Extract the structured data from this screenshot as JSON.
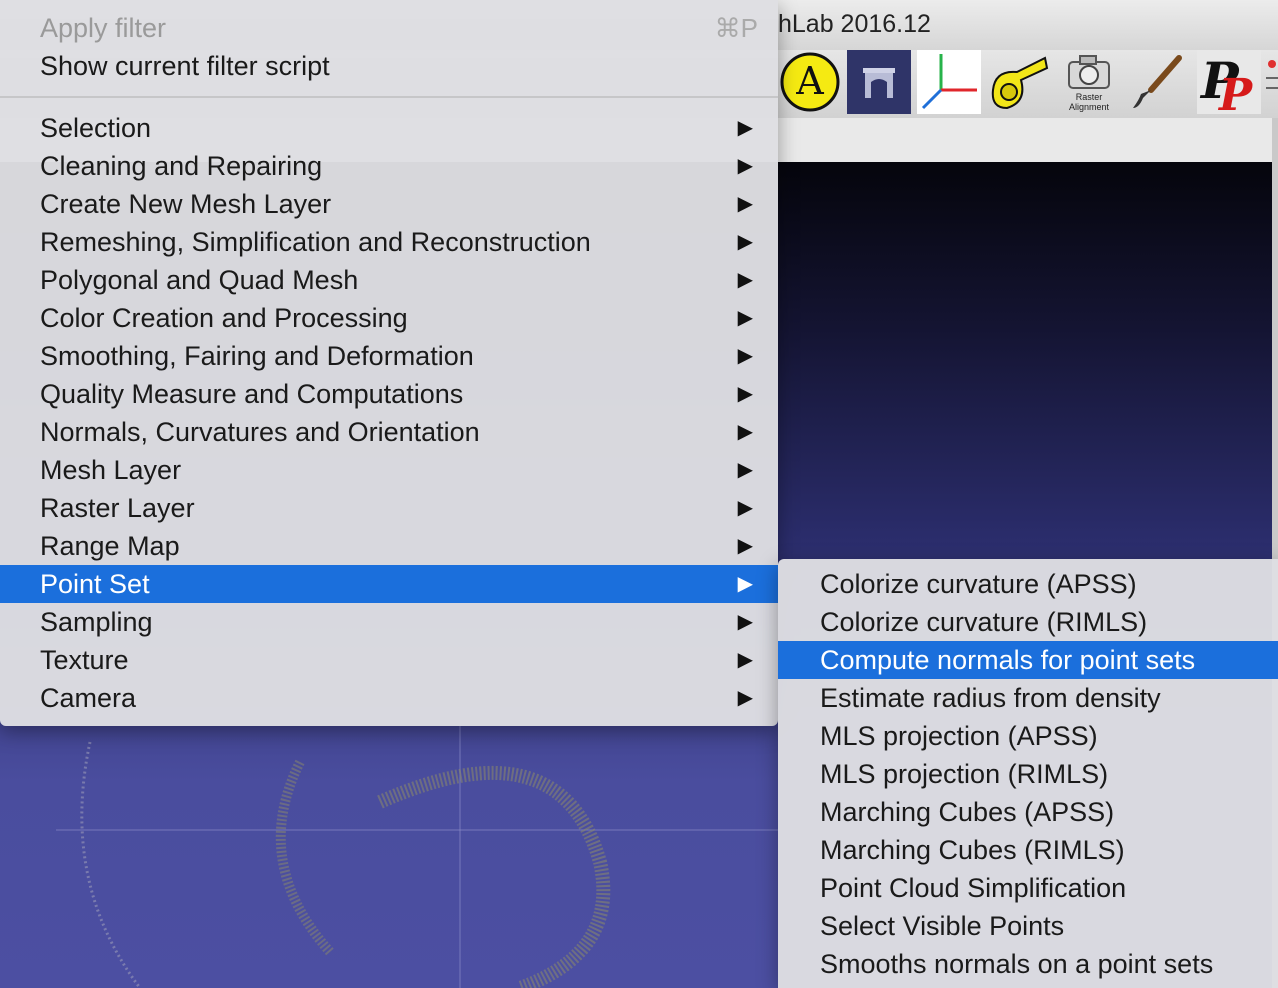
{
  "window": {
    "title_fragment": "hLab 2016.12"
  },
  "toolbar": {
    "tools": [
      {
        "name": "annotation-a-icon",
        "glyph": "A"
      },
      {
        "name": "arch-render-icon"
      },
      {
        "name": "axes-icon"
      },
      {
        "name": "measure-tape-icon"
      },
      {
        "name": "raster-alignment-icon",
        "label": "Raster Alignment"
      },
      {
        "name": "paint-brush-icon"
      },
      {
        "name": "pp-icon",
        "glyph": "P"
      }
    ]
  },
  "filters_menu": {
    "top_items": [
      {
        "label": "Apply filter",
        "shortcut": "⌘P",
        "disabled": true
      },
      {
        "label": "Show current filter script"
      }
    ],
    "categories": [
      {
        "label": "Selection"
      },
      {
        "label": "Cleaning and Repairing"
      },
      {
        "label": "Create New Mesh Layer"
      },
      {
        "label": "Remeshing, Simplification and Reconstruction"
      },
      {
        "label": "Polygonal and Quad Mesh"
      },
      {
        "label": "Color Creation and Processing"
      },
      {
        "label": "Smoothing, Fairing and Deformation"
      },
      {
        "label": "Quality Measure and Computations"
      },
      {
        "label": "Normals, Curvatures and Orientation"
      },
      {
        "label": "Mesh Layer"
      },
      {
        "label": "Raster Layer"
      },
      {
        "label": "Range Map"
      },
      {
        "label": "Point Set",
        "highlighted": true
      },
      {
        "label": "Sampling"
      },
      {
        "label": "Texture"
      },
      {
        "label": "Camera"
      }
    ],
    "submenu_arrow": "▶"
  },
  "point_set_submenu": {
    "items": [
      {
        "label": "Colorize curvature (APSS)"
      },
      {
        "label": "Colorize curvature (RIMLS)"
      },
      {
        "label": "Compute normals for point sets",
        "highlighted": true
      },
      {
        "label": "Estimate radius from density"
      },
      {
        "label": "MLS projection (APSS)"
      },
      {
        "label": "MLS projection (RIMLS)"
      },
      {
        "label": "Marching Cubes (APSS)"
      },
      {
        "label": "Marching Cubes (RIMLS)"
      },
      {
        "label": "Point Cloud Simplification"
      },
      {
        "label": "Select Visible Points"
      },
      {
        "label": "Smooths normals on a point sets"
      }
    ]
  },
  "colors": {
    "highlight": "#1b6fdc",
    "menu_bg": "#dedee2",
    "viewport_bottom": "#4a4d9e"
  }
}
